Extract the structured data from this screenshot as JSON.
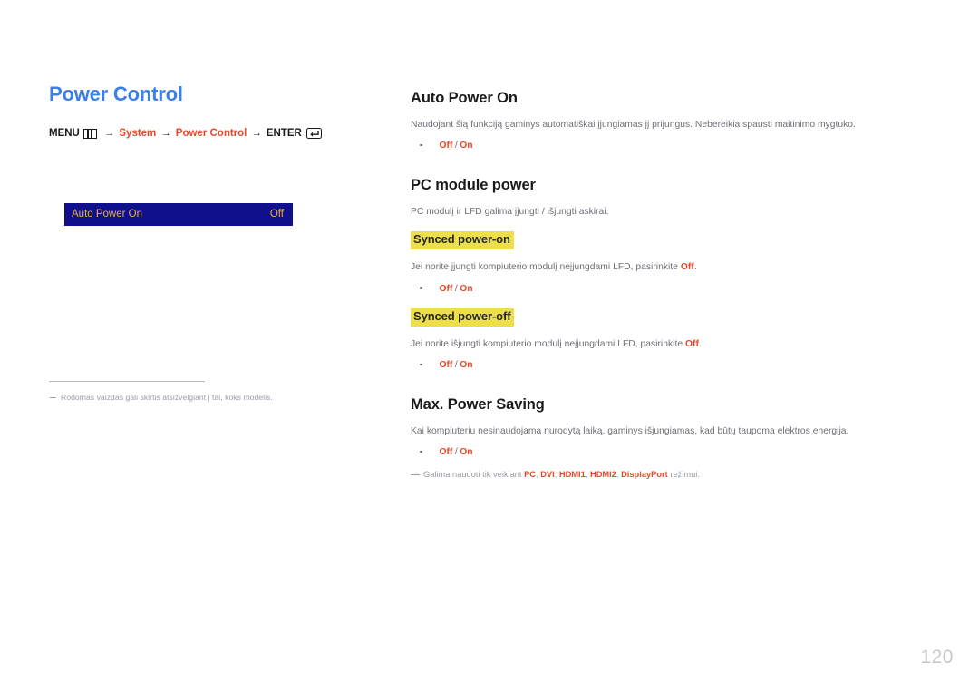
{
  "left": {
    "section_title": "Power Control",
    "menu_path": {
      "menu_label": "MENU",
      "menu_icon": "menu-grid-icon",
      "arrow": "→",
      "item1": "System",
      "item2": "Power Control",
      "enter_label": "ENTER",
      "enter_icon": "enter-key-icon"
    },
    "osd": {
      "label": "Auto Power On",
      "value": "Off"
    },
    "footnote": "Rodomas vaizdas gali skirtis atsižvelgiant į tai, koks modelis."
  },
  "right": {
    "sections": [
      {
        "heading": "Auto Power On",
        "description_pre": "Naudojant šią funkciją gaminys automatiškai įjungiamas jį prijungus. Nebereikia spausti maitinimo mygtuko.",
        "options": {
          "off": "Off",
          "sep": "/",
          "on": "On"
        }
      },
      {
        "heading": "PC module power",
        "description_pre": "PC modulį ir LFD galima įjungti / išjungti askirai."
      }
    ],
    "synced_power_on": {
      "heading": "Synced power-on",
      "desc_pre": "Jei norite įjungti kompiuterio modulį neįjungdami LFD, pasirinkite ",
      "desc_bold": "Off",
      "desc_post": ".",
      "options": {
        "off": "Off",
        "sep": "/",
        "on": "On"
      }
    },
    "synced_power_off": {
      "heading": "Synced power-off",
      "desc_pre": "Jei norite išjungti kompiuterio modulį neįjungdami LFD, pasirinkite ",
      "desc_bold": "Off",
      "desc_post": ".",
      "options": {
        "off": "Off",
        "sep": "/",
        "on": "On"
      }
    },
    "max_power_saving": {
      "heading": "Max. Power Saving",
      "description": "Kai kompiuteriu nesinaudojama nurodytą laiką, gaminys išjungiamas, kad būtų taupoma elektros energija.",
      "options": {
        "off": "Off",
        "sep": "/",
        "on": "On"
      },
      "footnote_pre": "Galima naudoti tik veikiant ",
      "footnote_modes": [
        "PC",
        "DVI",
        "HDMI1",
        "HDMI2",
        "DisplayPort"
      ],
      "footnote_post": " režimui."
    }
  },
  "page_number": "120",
  "colors": {
    "accent_blue": "#3b7fe8",
    "accent_red": "#e8482a",
    "osd_bg": "#10108c",
    "osd_text": "#e7b33a",
    "highlight_yellow": "#ecdf4a",
    "body_gray": "#6e6e78",
    "note_gray": "#9a9aab"
  }
}
